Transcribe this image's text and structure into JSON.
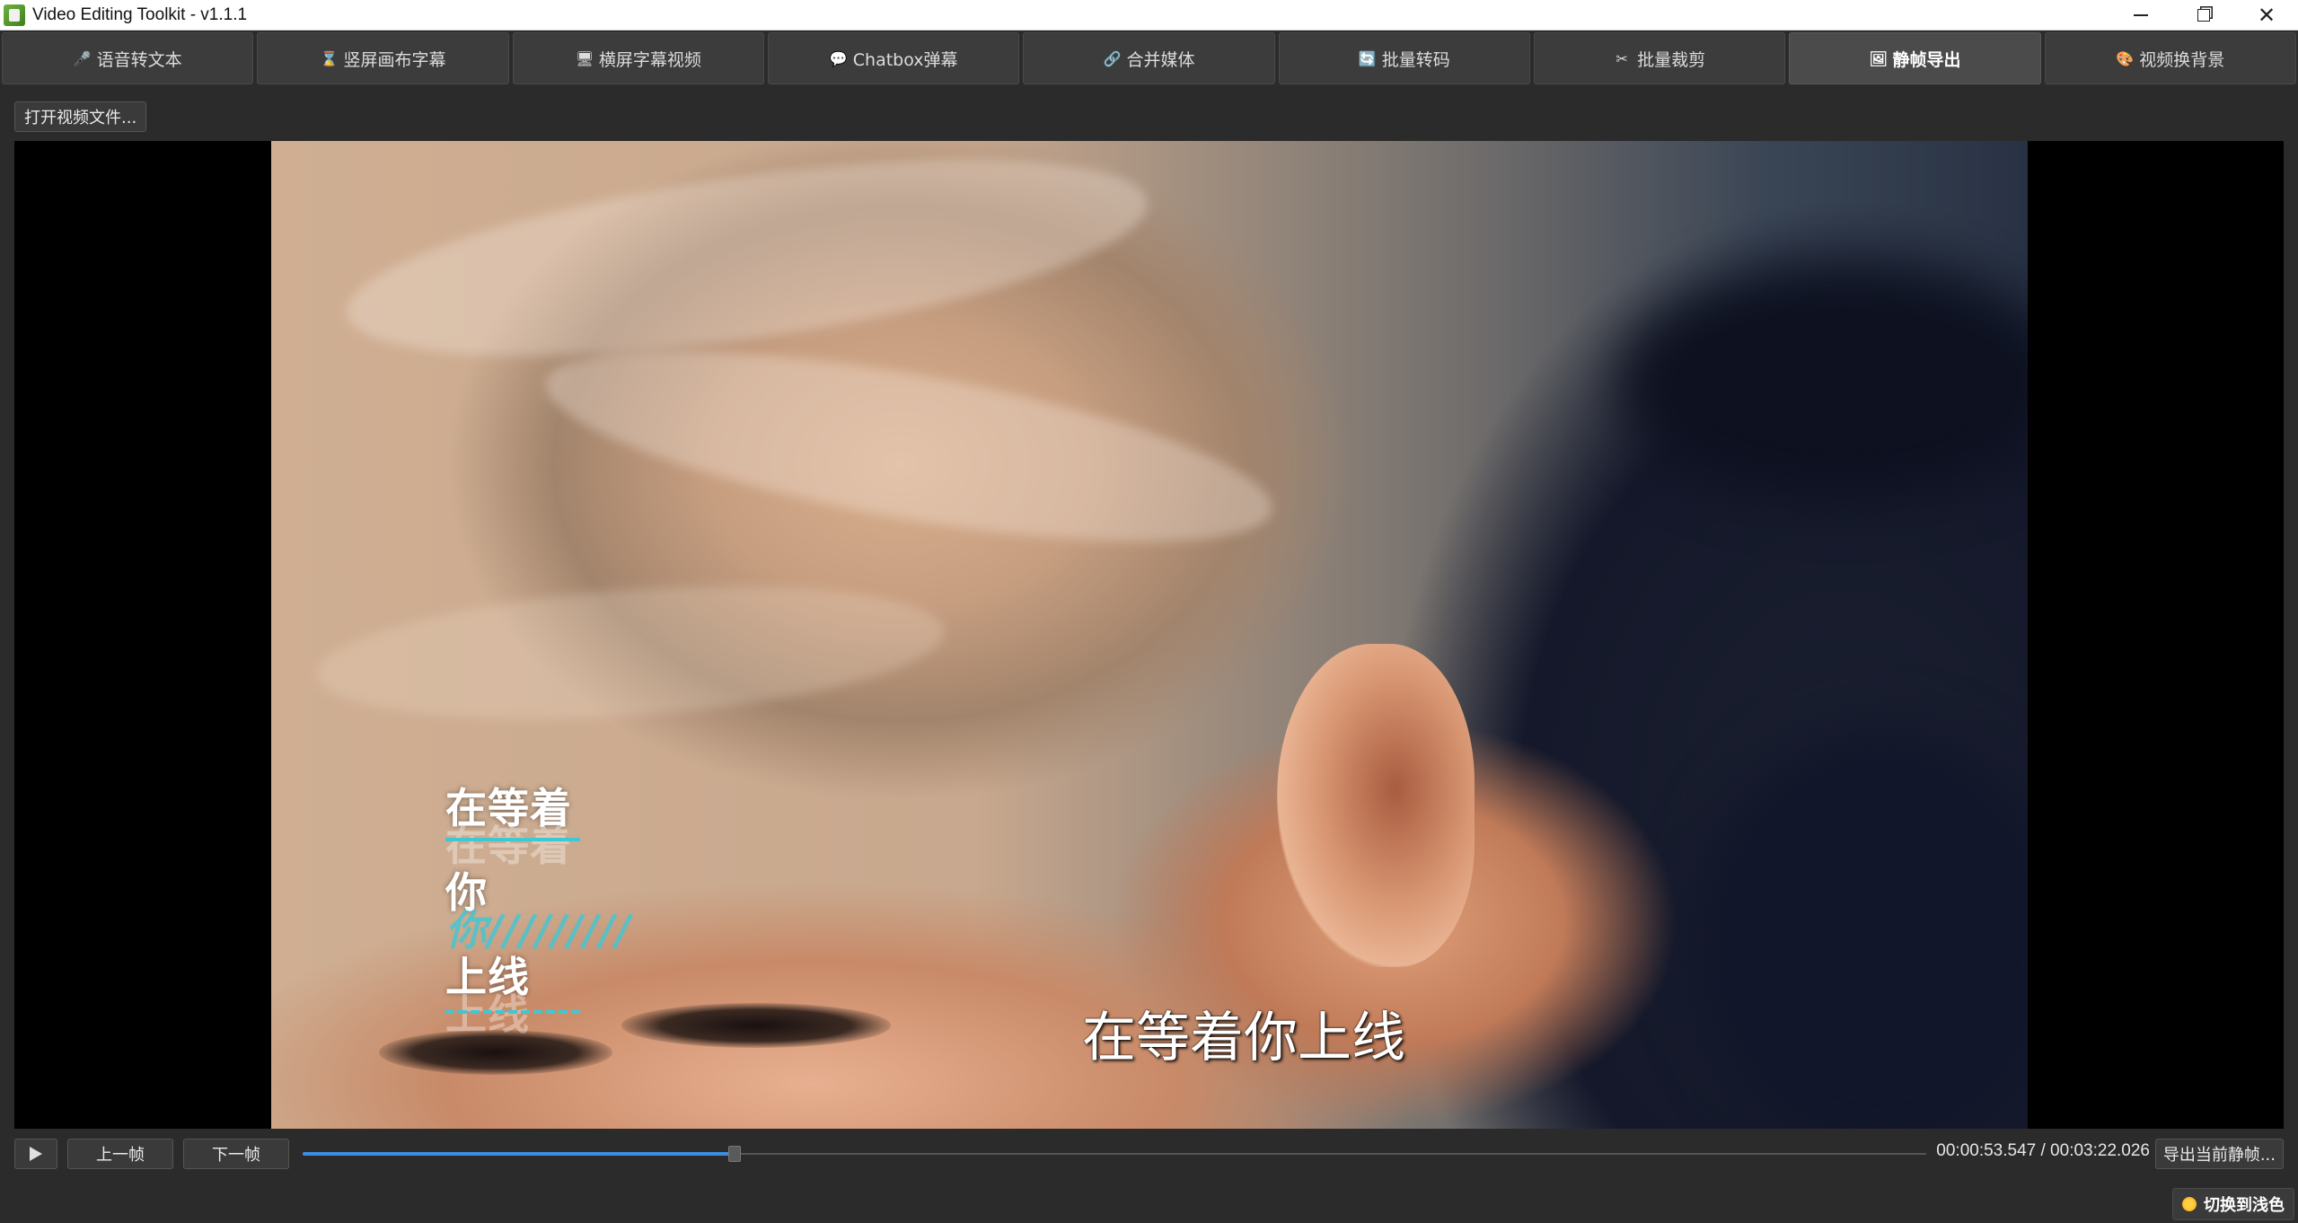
{
  "window": {
    "title": "Video Editing Toolkit - v1.1.1"
  },
  "tabs": [
    {
      "label": "语音转文本",
      "icon": "microphone-icon",
      "icon_glyph": "🎤"
    },
    {
      "label": "竖屏画布字幕",
      "icon": "hourglass-icon",
      "icon_glyph": "⌛"
    },
    {
      "label": "横屏字幕视频",
      "icon": "monitor-icon",
      "icon_glyph": "🖥"
    },
    {
      "label": "Chatbox弹幕",
      "icon": "speech-bubble-icon",
      "icon_glyph": "💬"
    },
    {
      "label": "合并媒体",
      "icon": "link-icon",
      "icon_glyph": "🔗"
    },
    {
      "label": "批量转码",
      "icon": "refresh-icon",
      "icon_glyph": "🔄"
    },
    {
      "label": "批量裁剪",
      "icon": "scissors-icon",
      "icon_glyph": "✂"
    },
    {
      "label": "静帧导出",
      "icon": "picture-icon",
      "icon_glyph": "🖼",
      "active": true
    },
    {
      "label": "视频换背景",
      "icon": "palette-icon",
      "icon_glyph": "🎨"
    }
  ],
  "toolbar": {
    "open_video_label": "打开视频文件..."
  },
  "video": {
    "lyrics": [
      {
        "text": "在等着",
        "ghost": "在等着",
        "ghost_style": "strike"
      },
      {
        "text": "你",
        "ghost": "你/////////",
        "ghost_style": "slash"
      },
      {
        "text": "上线",
        "ghost": "上线",
        "ghost_style": "dash"
      }
    ],
    "subtitle": "在等着你上线"
  },
  "controls": {
    "play_icon": "play-icon",
    "prev_frame_label": "上一帧",
    "next_frame_label": "下一帧",
    "progress": 0.266,
    "time_display": "00:00:53.547 / 00:03:22.026",
    "export_label": "导出当前静帧...",
    "theme_toggle_label": "切换到浅色",
    "theme_icon": "sun-icon"
  },
  "colors": {
    "accent": "#3d8fe0",
    "lyric_accent": "#3fc7d4",
    "background": "#2b2b2b"
  }
}
